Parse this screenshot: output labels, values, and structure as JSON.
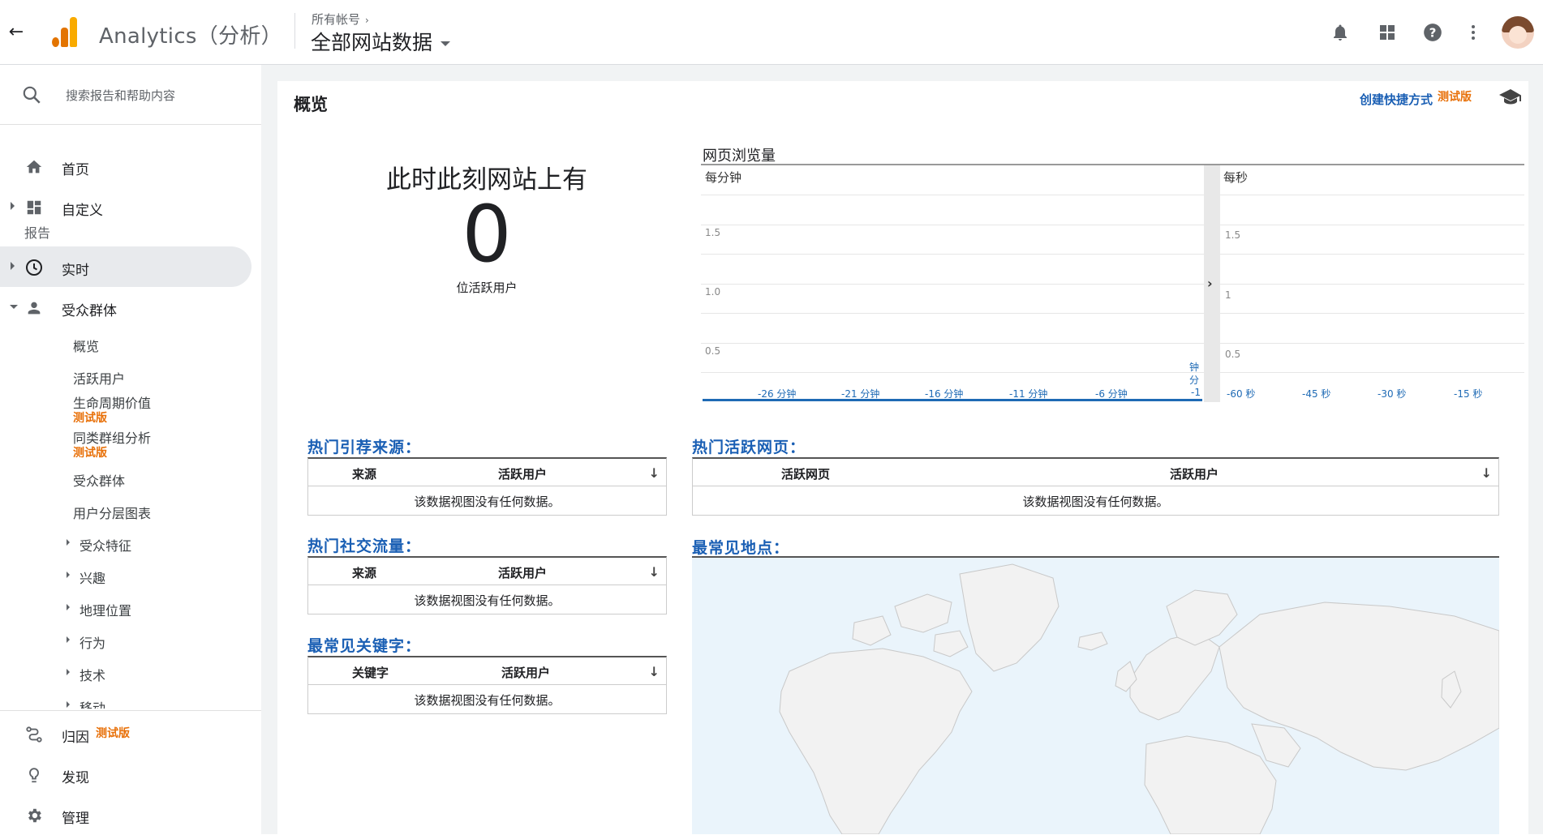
{
  "header": {
    "back_icon": "arrow-back-icon",
    "app_name": "Analytics（分析）",
    "breadcrumb": "所有帐号",
    "property": "全部网站数据",
    "icons": [
      "bell-icon",
      "apps-icon",
      "help-icon",
      "more-vert-icon"
    ],
    "brand_orange": "#e37400",
    "brand_yellow": "#f9ab00"
  },
  "sidebar": {
    "search_placeholder": "搜索报告和帮助内容",
    "home": "首页",
    "customize": "自定义",
    "reports_label": "报告",
    "realtime": "实时",
    "audience": "受众群体",
    "audience_items": {
      "overview": "概览",
      "active_users": "活跃用户",
      "lifetime_value": "生命周期价值",
      "lifetime_value_beta": "测试版",
      "cohort": "同类群组分析",
      "cohort_beta": "测试版",
      "audiences": "受众群体",
      "user_explorer": "用户分层图表",
      "demographics": "受众特征",
      "interests": "兴趣",
      "geo": "地理位置",
      "behavior": "行为",
      "technology": "技术",
      "mobile": "移动"
    },
    "attribution": "归因",
    "attribution_beta": "测试版",
    "discover": "发现",
    "admin": "管理"
  },
  "main": {
    "page_title": "概览",
    "shortcut": "创建快捷方式",
    "shortcut_beta": "测试版",
    "live_title": "此时此刻网站上有",
    "live_count": "0",
    "live_sub": "位活跃用户",
    "pageviews_title": "网页浏览量",
    "per_minute": "每分钟",
    "per_second": "每秒",
    "accent": "#1e6ab5",
    "minute_y_ticks": [
      "1.5",
      "1.0",
      "0.5"
    ],
    "minute_x_ticks": [
      "-26 分钟",
      "-21 分钟",
      "-16 分钟",
      "-11 分钟",
      "-6 分钟"
    ],
    "minute_last_tick": {
      "l1": "钟",
      "l2": "分",
      "l3": "-1"
    },
    "second_y_ticks": [
      "1.5",
      "1",
      "0.5"
    ],
    "second_x_ticks": [
      "-60 秒",
      "-45 秒",
      "-30 秒",
      "-15 秒"
    ],
    "tables": {
      "referrals": {
        "title": "热门引荐来源：",
        "col1": "来源",
        "col2": "活跃用户",
        "empty": "该数据视图没有任何数据。"
      },
      "social": {
        "title": "热门社交流量：",
        "col1": "来源",
        "col2": "活跃用户",
        "empty": "该数据视图没有任何数据。"
      },
      "keywords": {
        "title": "最常见关键字：",
        "col1": "关键字",
        "col2": "活跃用户",
        "empty": "该数据视图没有任何数据。"
      },
      "pages": {
        "title": "热门活跃网页：",
        "col1": "活跃网页",
        "col2": "活跃用户",
        "empty": "该数据视图没有任何数据。"
      }
    },
    "locations_title": "最常见地点："
  }
}
